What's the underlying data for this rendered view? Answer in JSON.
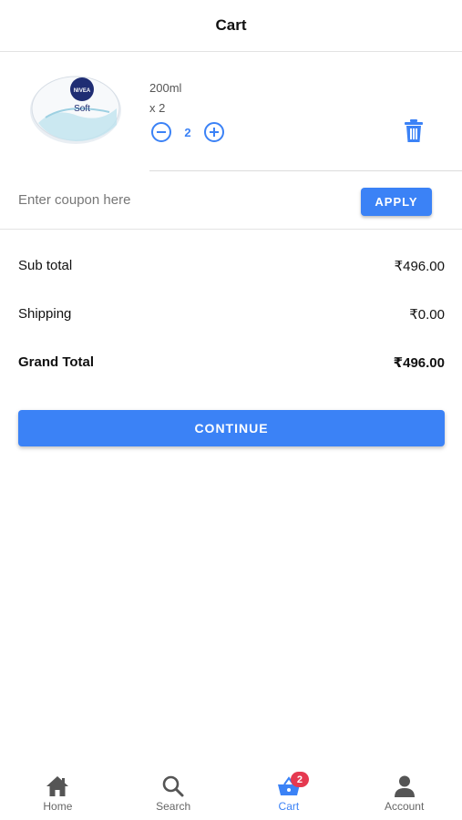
{
  "header": {
    "title": "Cart"
  },
  "cart_item": {
    "size": "200ml",
    "quantity_label": "x 2",
    "quantity": "2",
    "brand_text": "NIVEA",
    "product_text": "Soft"
  },
  "coupon": {
    "placeholder": "Enter coupon here",
    "value": "",
    "apply_label": "APPLY"
  },
  "summary": {
    "subtotal_label": "Sub total",
    "subtotal_value": "₹496.00",
    "shipping_label": "Shipping",
    "shipping_value": "₹0.00",
    "grand_total_label": "Grand Total",
    "grand_total_value": "₹496.00"
  },
  "continue_label": "CONTINUE",
  "nav": {
    "items": [
      {
        "label": "Home",
        "icon": "home-icon"
      },
      {
        "label": "Search",
        "icon": "search-icon"
      },
      {
        "label": "Cart",
        "icon": "basket-icon",
        "badge": "2",
        "active": true
      },
      {
        "label": "Account",
        "icon": "person-icon"
      }
    ]
  },
  "colors": {
    "accent": "#3b82f6",
    "badge": "#e53950",
    "nivea_blue": "#1f2d73"
  }
}
